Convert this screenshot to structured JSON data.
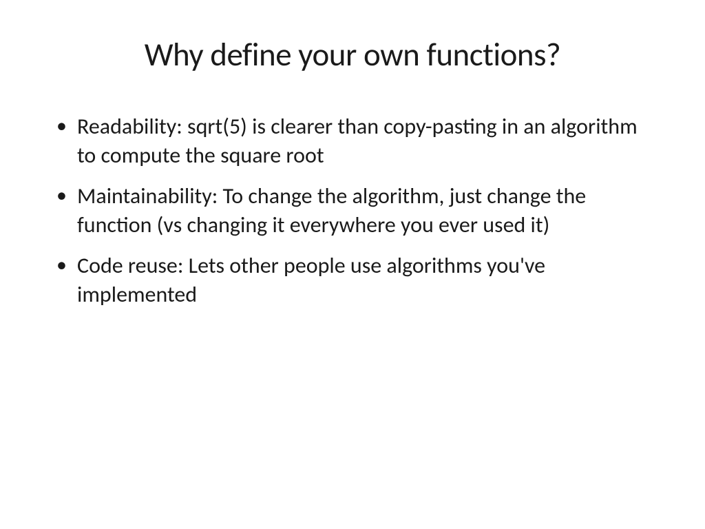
{
  "slide": {
    "title": "Why define your own functions?",
    "bullets": [
      "Readability: sqrt(5) is clearer than copy-pasting in an algorithm to compute the square root",
      "Maintainability: To change the algorithm, just change the function (vs changing it everywhere you ever used it)",
      "Code reuse: Lets other people use algorithms you've implemented"
    ]
  }
}
